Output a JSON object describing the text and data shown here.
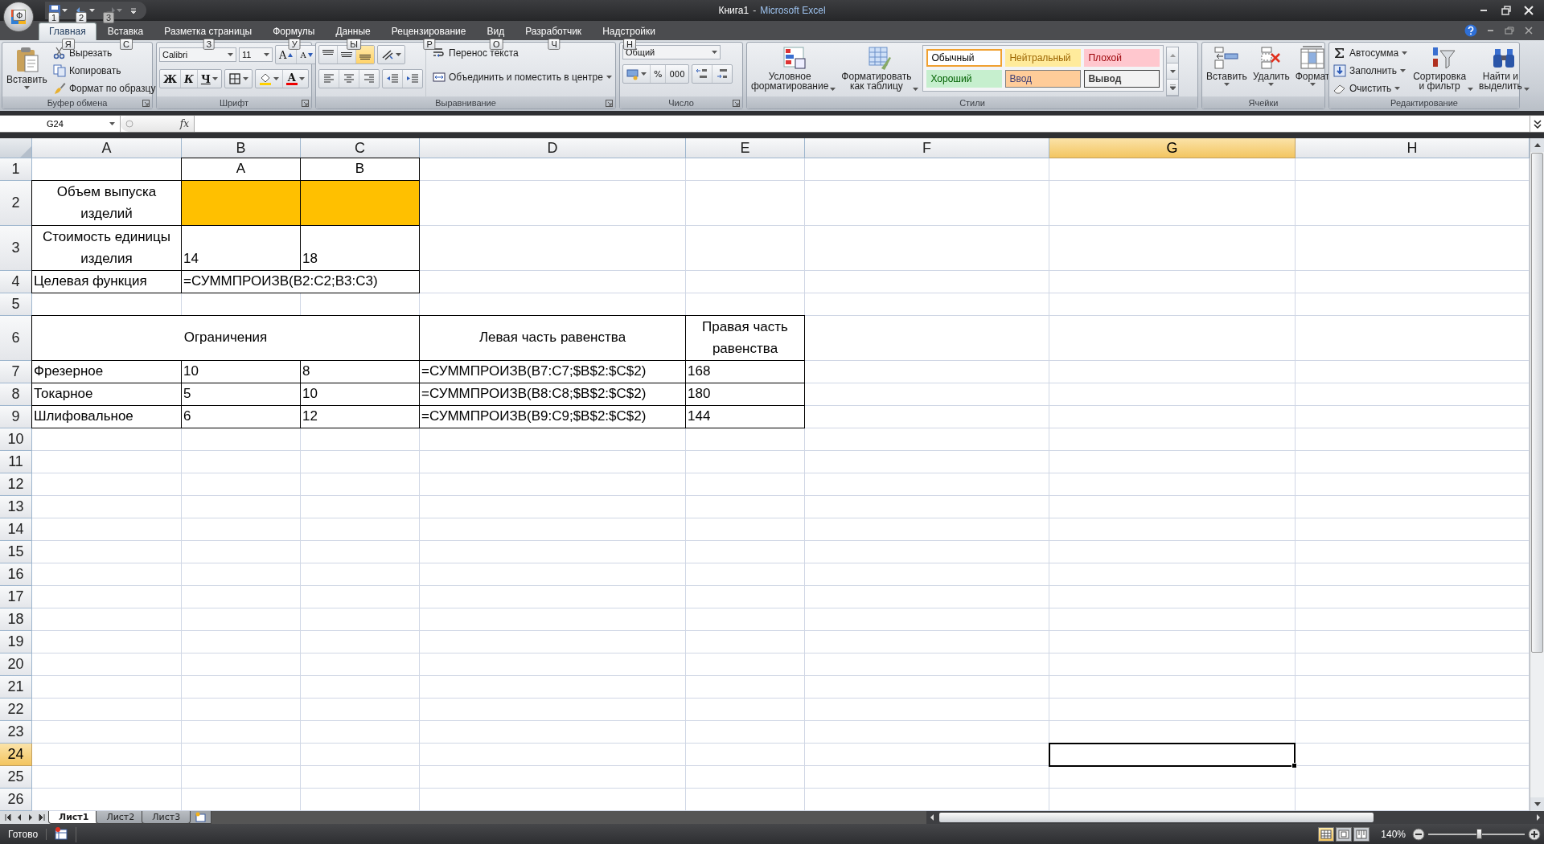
{
  "window": {
    "document": "Книга1",
    "separator": "-",
    "app": "Microsoft Excel"
  },
  "office_button": {
    "key_tip": "Ф"
  },
  "quick_access": [
    {
      "kind": "save",
      "key_tip": "1",
      "disabled": false
    },
    {
      "kind": "undo",
      "key_tip": "2",
      "disabled": false
    },
    {
      "kind": "redo",
      "key_tip": "3",
      "disabled": true
    }
  ],
  "tabs": [
    {
      "label": "Главная",
      "key_tip": "Я",
      "selected": true
    },
    {
      "label": "Вставка",
      "key_tip": "С",
      "selected": false
    },
    {
      "label": "Разметка страницы",
      "key_tip": "З",
      "selected": false
    },
    {
      "label": "Формулы",
      "key_tip": "У",
      "selected": false
    },
    {
      "label": "Данные",
      "key_tip": "Ы",
      "selected": false
    },
    {
      "label": "Рецензирование",
      "key_tip": "Р",
      "selected": false
    },
    {
      "label": "Вид",
      "key_tip": "О",
      "selected": false
    },
    {
      "label": "Разработчик",
      "key_tip": "Ч",
      "selected": false
    },
    {
      "label": "Надстройки",
      "key_tip": "Н",
      "selected": false
    }
  ],
  "ribbon": {
    "clipboard": {
      "title": "Буфер обмена",
      "paste": "Вставить",
      "cut": "Вырезать",
      "copy": "Копировать",
      "format_painter": "Формат по образцу"
    },
    "font": {
      "title": "Шрифт",
      "family": "Calibri",
      "size": "11",
      "grow": "A",
      "shrink": "A",
      "bold": "Ж",
      "italic": "К",
      "underline": "Ч",
      "font_color_label": "A"
    },
    "alignment": {
      "title": "Выравнивание",
      "wrap": "Перенос текста",
      "merge": "Объединить и поместить в центре"
    },
    "number": {
      "title": "Число",
      "format": "Общий",
      "percent": "%",
      "thousands": "000"
    },
    "styles": {
      "title": "Стили",
      "conditional": "Условное\nформатирование",
      "as_table": "Форматировать\nкак таблицу",
      "gallery": [
        {
          "label": "Обычный",
          "kind": "normal",
          "selected": true
        },
        {
          "label": "Нейтральный",
          "kind": "neutral",
          "selected": false
        },
        {
          "label": "Плохой",
          "kind": "bad",
          "selected": false
        },
        {
          "label": "Хороший",
          "kind": "good",
          "selected": false
        },
        {
          "label": "Ввод",
          "kind": "input",
          "selected": false
        },
        {
          "label": "Вывод",
          "kind": "output",
          "selected": false
        }
      ]
    },
    "cells": {
      "title": "Ячейки",
      "insert": "Вставить",
      "delete": "Удалить",
      "format": "Формат"
    },
    "editing": {
      "title": "Редактирование",
      "autosum": "Автосумма",
      "fill": "Заполнить",
      "clear": "Очистить",
      "sort": "Сортировка\nи фильтр",
      "find": "Найти и\nвыделить"
    }
  },
  "formula_bar": {
    "name_box": "G24",
    "function_label": "fx"
  },
  "sheet": {
    "columns": [
      {
        "label": "A",
        "selected": false
      },
      {
        "label": "B",
        "selected": false
      },
      {
        "label": "C",
        "selected": false
      },
      {
        "label": "D",
        "selected": false
      },
      {
        "label": "E",
        "selected": false
      },
      {
        "label": "F",
        "selected": false
      },
      {
        "label": "G",
        "selected": true
      },
      {
        "label": "H",
        "selected": false
      }
    ],
    "rows": [
      {
        "label": "1",
        "selected": false,
        "cells": [
          {
            "bordered": false
          },
          {
            "text": "A",
            "kind": "centered",
            "bordered": true
          },
          {
            "text": "B",
            "kind": "centered",
            "bordered": true
          }
        ]
      },
      {
        "label": "2",
        "selected": false,
        "cells": [
          {
            "text": "Объем выпуска изделий",
            "kind": "wrapped",
            "bordered": true
          },
          {
            "bordered": true,
            "color": "#ffc000"
          },
          {
            "bordered": true,
            "color": "#ffc000"
          }
        ]
      },
      {
        "label": "3",
        "selected": false,
        "cells": [
          {
            "text": "Стоимость единицы изделия",
            "kind": "wrapped",
            "bordered": true
          },
          {
            "text": "14",
            "kind": "plain",
            "bordered": true
          },
          {
            "text": "18",
            "kind": "plain",
            "bordered": true
          }
        ]
      },
      {
        "label": "4",
        "selected": false,
        "cells": [
          {
            "text": "Целевая функция",
            "kind": "plain",
            "bordered": true
          },
          {
            "text": "=СУММПРОИЗВ(B2:C2;B3:C3)",
            "kind": "plain",
            "bordered": true,
            "colspan": 2
          }
        ]
      },
      {
        "label": "5",
        "selected": false,
        "cells": []
      },
      {
        "label": "6",
        "selected": false,
        "cells": [
          {
            "text": "Ограничения",
            "kind": "centered",
            "bordered": true,
            "colspan": 3
          },
          {
            "text": "Левая часть равенства",
            "kind": "centered",
            "bordered": true
          },
          {
            "text": "Правая часть равенства",
            "kind": "wrapped",
            "bordered": true
          }
        ]
      },
      {
        "label": "7",
        "selected": false,
        "cells": [
          {
            "text": "Фрезерное",
            "kind": "plain",
            "bordered": true
          },
          {
            "text": "10",
            "kind": "plain",
            "bordered": true
          },
          {
            "text": "8",
            "kind": "plain",
            "bordered": true
          },
          {
            "text": "=СУММПРОИЗВ(B7:C7;$B$2:$C$2)",
            "kind": "plain",
            "bordered": true
          },
          {
            "text": "168",
            "kind": "plain",
            "bordered": true
          }
        ]
      },
      {
        "label": "8",
        "selected": false,
        "cells": [
          {
            "text": "Токарное",
            "kind": "plain",
            "bordered": true
          },
          {
            "text": "5",
            "kind": "plain",
            "bordered": true
          },
          {
            "text": "10",
            "kind": "plain",
            "bordered": true
          },
          {
            "text": "=СУММПРОИЗВ(B8:C8;$B$2:$C$2)",
            "kind": "plain",
            "bordered": true
          },
          {
            "text": "180",
            "kind": "plain",
            "bordered": true
          }
        ]
      },
      {
        "label": "9",
        "selected": false,
        "cells": [
          {
            "text": "Шлифовальное",
            "kind": "plain",
            "bordered": true
          },
          {
            "text": "6",
            "kind": "plain",
            "bordered": true
          },
          {
            "text": "12",
            "kind": "plain",
            "bordered": true
          },
          {
            "text": "=СУММПРОИЗВ(B9:C9;$B$2:$C$2)",
            "kind": "plain",
            "bordered": true
          },
          {
            "text": "144",
            "kind": "plain",
            "bordered": true
          }
        ]
      },
      {
        "label": "10",
        "selected": false,
        "cells": []
      },
      {
        "label": "11",
        "selected": false,
        "cells": []
      },
      {
        "label": "12",
        "selected": false,
        "cells": []
      },
      {
        "label": "13",
        "selected": false,
        "cells": []
      },
      {
        "label": "14",
        "selected": false,
        "cells": []
      },
      {
        "label": "15",
        "selected": false,
        "cells": []
      },
      {
        "label": "16",
        "selected": false,
        "cells": []
      },
      {
        "label": "17",
        "selected": false,
        "cells": []
      },
      {
        "label": "18",
        "selected": false,
        "cells": []
      },
      {
        "label": "19",
        "selected": false,
        "cells": []
      },
      {
        "label": "20",
        "selected": false,
        "cells": []
      },
      {
        "label": "21",
        "selected": false,
        "cells": []
      },
      {
        "label": "22",
        "selected": false,
        "cells": []
      },
      {
        "label": "23",
        "selected": false,
        "cells": []
      },
      {
        "label": "24",
        "selected": true,
        "cells": []
      },
      {
        "label": "25",
        "selected": false,
        "cells": []
      },
      {
        "label": "26",
        "selected": false,
        "cells": []
      }
    ]
  },
  "sheet_tabs": [
    {
      "label": "Лист1",
      "selected": true
    },
    {
      "label": "Лист2",
      "selected": false
    },
    {
      "label": "Лист3",
      "selected": false
    }
  ],
  "status_bar": {
    "text": "Готово",
    "views": [
      {
        "kind": "normal",
        "selected": true
      },
      {
        "kind": "page_layout",
        "selected": false
      },
      {
        "kind": "page_break",
        "selected": false
      }
    ],
    "zoom": "140%",
    "zoom_slider": {
      "level": 0.53
    }
  }
}
